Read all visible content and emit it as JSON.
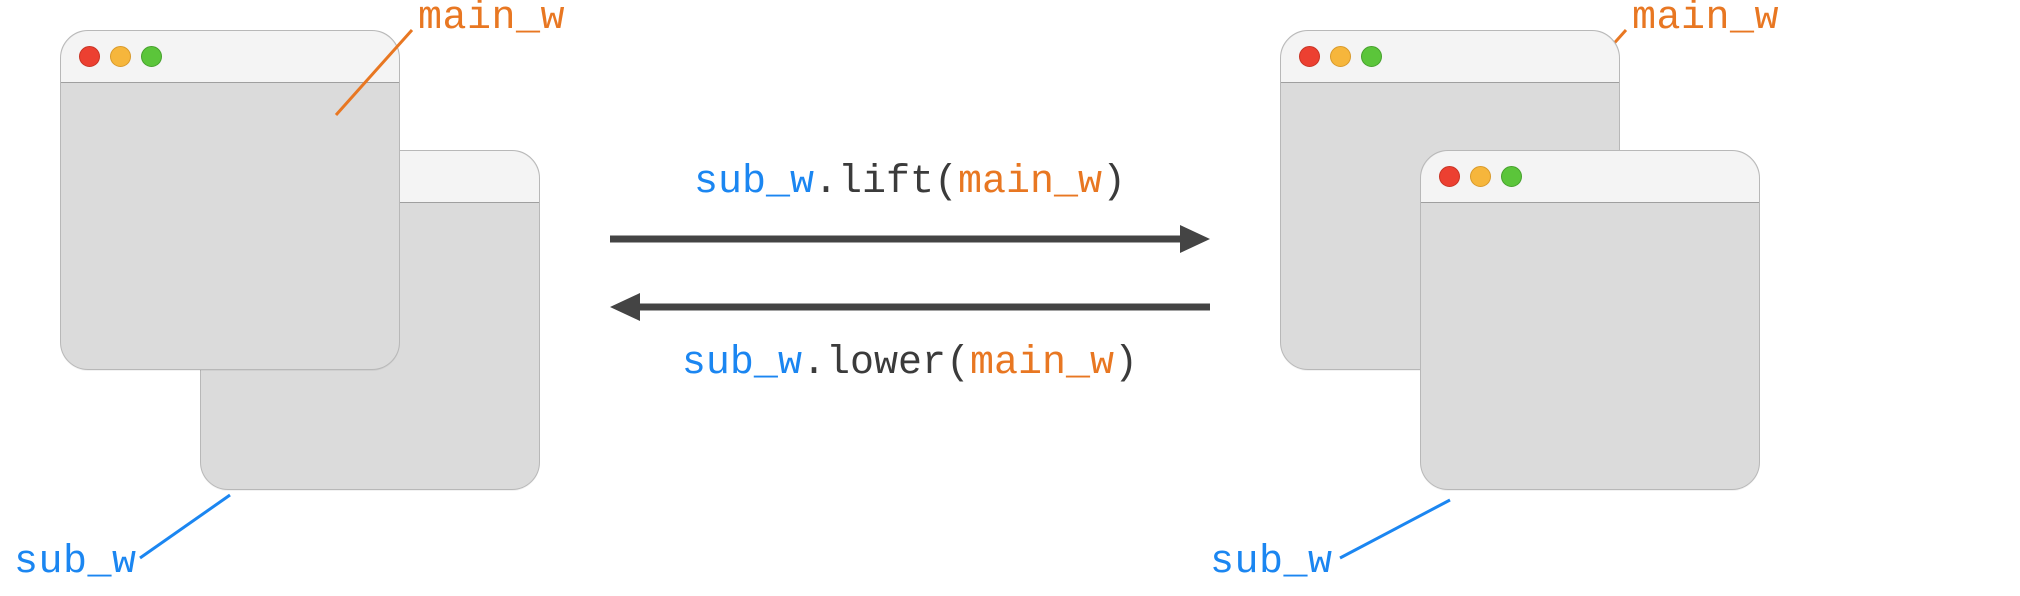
{
  "labels": {
    "main_w": "main_w",
    "sub_w": "sub_w"
  },
  "code": {
    "lift": {
      "obj": "sub_w",
      "dot": ".",
      "method": "lift",
      "open": "(",
      "arg": "main_w",
      "close": ")"
    },
    "lower": {
      "obj": "sub_w",
      "dot": ".",
      "method": "lower",
      "open": "(",
      "arg": "main_w",
      "close": ")"
    }
  },
  "colors": {
    "orange": "#e87722",
    "blue": "#1b86f1",
    "arrow": "#444444",
    "window_bg": "#dbdbdb",
    "titlebar_bg": "#f4f4f4"
  }
}
